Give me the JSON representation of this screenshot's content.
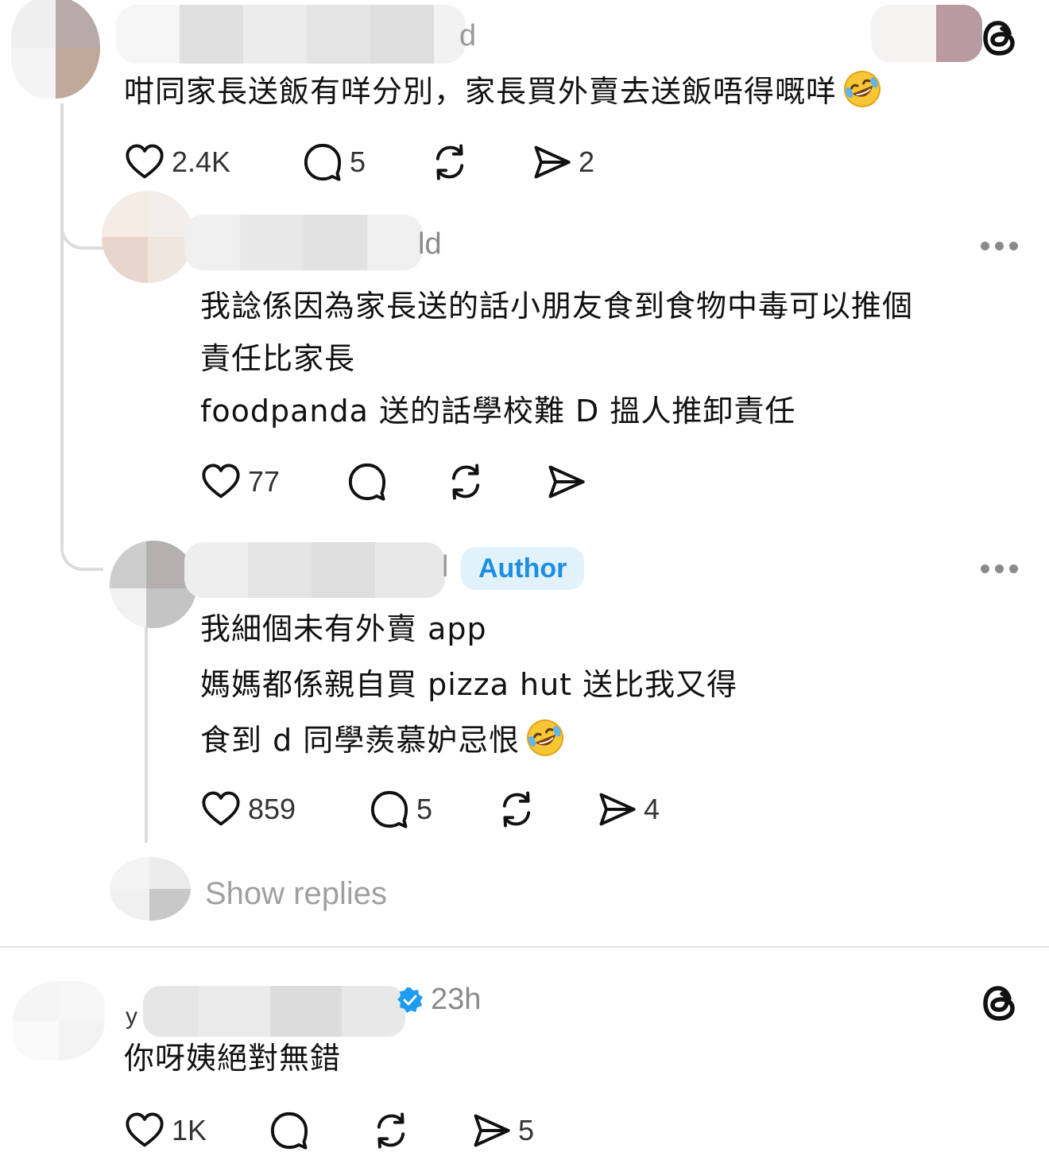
{
  "comments": [
    {
      "username_suffix": "d",
      "body": [
        "咁同家長送飯有咩分別，家長買外賣去送飯唔得嘅咩"
      ],
      "body_emoji": "rolling-on-floor-laughing-emoji",
      "likes": "2.4K",
      "replies": "5",
      "shares": "2"
    },
    {
      "username_suffix": "ld",
      "body": [
        "我諗係因為家長送的話小朋友食到食物中毒可以推個",
        "責任比家長",
        "foodpanda 送的話學校難 D 搵人推卸責任"
      ],
      "likes": "77",
      "replies": "",
      "shares": ""
    },
    {
      "username_suffix": "l",
      "badge": "Author",
      "body": [
        "我細個未有外賣 app",
        "媽媽都係親自買 pizza hut 送比我又得",
        "食到 d 同學羨慕妒忌恨"
      ],
      "body_emoji": "rolling-on-floor-laughing-emoji",
      "likes": "859",
      "replies": "5",
      "shares": "4"
    },
    {
      "username_suffix": "y",
      "time": "23h",
      "verified": true,
      "body": [
        "你呀姨絕對無錯"
      ],
      "likes": "1K",
      "replies": "",
      "shares": "5"
    }
  ],
  "show_replies_label": "Show replies",
  "icons": {
    "like": "heart-icon",
    "reply": "comment-bubble-icon",
    "repost": "repost-icon",
    "share": "send-icon",
    "more": "more-options-icon",
    "brand": "threads-logo-icon"
  },
  "colors": {
    "author_badge_bg": "#e2f2fc",
    "author_badge_text": "#1d8ee0",
    "verified": "#1d9bf0",
    "muted": "#8a8a8a"
  }
}
